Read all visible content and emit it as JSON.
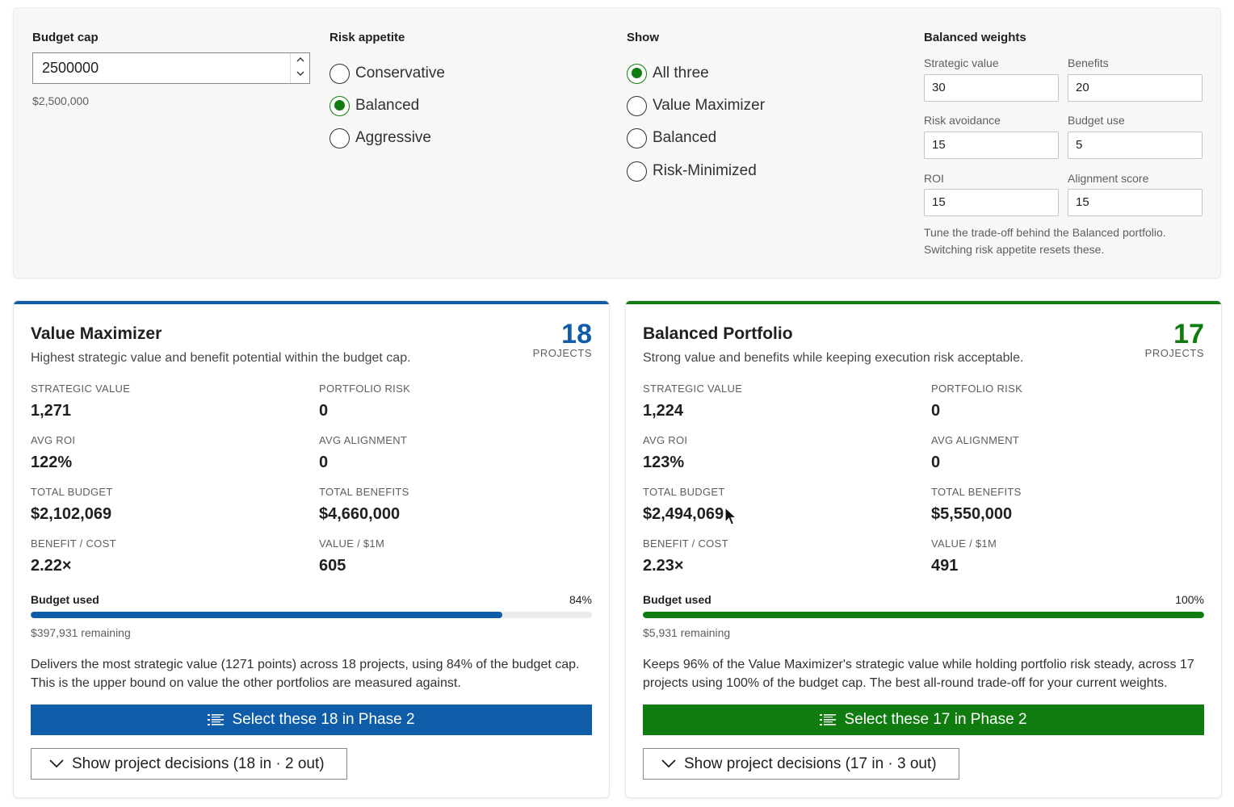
{
  "controls": {
    "budget": {
      "title": "Budget cap",
      "value": "2500000",
      "hint": "$2,500,000"
    },
    "risk": {
      "title": "Risk appetite",
      "options": [
        "Conservative",
        "Balanced",
        "Aggressive"
      ],
      "selected": "Balanced"
    },
    "show": {
      "title": "Show",
      "options": [
        "All three",
        "Value Maximizer",
        "Balanced",
        "Risk-Minimized"
      ],
      "selected": "All three"
    },
    "weights": {
      "title": "Balanced weights",
      "strategic_label": "Strategic value",
      "strategic_value": "30",
      "benefits_label": "Benefits",
      "benefits_value": "20",
      "risk_label": "Risk avoidance",
      "risk_value": "15",
      "budget_label": "Budget use",
      "budget_value": "5",
      "roi_label": "ROI",
      "roi_value": "15",
      "alignment_label": "Alignment score",
      "alignment_value": "15",
      "help_line1": "Tune the trade-off behind the Balanced portfolio.",
      "help_line2": "Switching risk appetite resets these."
    }
  },
  "cards": [
    {
      "accent": "#0f5ca8",
      "title": "Value Maximizer",
      "description": "Highest strategic value and benefit potential within the budget cap.",
      "count": "18",
      "count_label": "PROJECTS",
      "metrics": {
        "strategic_label": "STRATEGIC VALUE",
        "strategic_value": "1,271",
        "risk_label": "PORTFOLIO RISK",
        "risk_value": "0",
        "roi_label": "AVG ROI",
        "roi_value": "122%",
        "alignment_label": "AVG ALIGNMENT",
        "alignment_value": "0",
        "budget_label": "TOTAL BUDGET",
        "budget_value": "$2,102,069",
        "benefits_label": "TOTAL BENEFITS",
        "benefits_value": "$4,660,000",
        "bc_label": "BENEFIT / COST",
        "bc_value": "2.22×",
        "vpm_label": "VALUE / $1M",
        "vpm_value": "605"
      },
      "budget_used_label": "Budget used",
      "budget_used_pct": "84%",
      "budget_used_fraction": 0.84,
      "remaining": "$397,931 remaining",
      "summary": "Delivers the most strategic value (1271 points) across 18 projects, using 84% of the budget cap. This is the upper bound on value the other portfolios are measured against.",
      "select_label": "Select these 18 in Phase 2",
      "decisions_label": "Show project decisions (18 in · 2 out)"
    },
    {
      "accent": "#107c10",
      "title": "Balanced Portfolio",
      "description": "Strong value and benefits while keeping execution risk acceptable.",
      "count": "17",
      "count_label": "PROJECTS",
      "metrics": {
        "strategic_label": "STRATEGIC VALUE",
        "strategic_value": "1,224",
        "risk_label": "PORTFOLIO RISK",
        "risk_value": "0",
        "roi_label": "AVG ROI",
        "roi_value": "123%",
        "alignment_label": "AVG ALIGNMENT",
        "alignment_value": "0",
        "budget_label": "TOTAL BUDGET",
        "budget_value": "$2,494,069",
        "benefits_label": "TOTAL BENEFITS",
        "benefits_value": "$5,550,000",
        "bc_label": "BENEFIT / COST",
        "bc_value": "2.23×",
        "vpm_label": "VALUE / $1M",
        "vpm_value": "491"
      },
      "budget_used_label": "Budget used",
      "budget_used_pct": "100%",
      "budget_used_fraction": 1.0,
      "remaining": "$5,931 remaining",
      "summary": "Keeps 96% of the Value Maximizer's strategic value while holding portfolio risk steady, across 17 projects using 100% of the budget cap. The best all-round trade-off for your current weights.",
      "select_label": "Select these 17 in Phase 2",
      "decisions_label": "Show project decisions (17 in · 3 out)"
    }
  ]
}
